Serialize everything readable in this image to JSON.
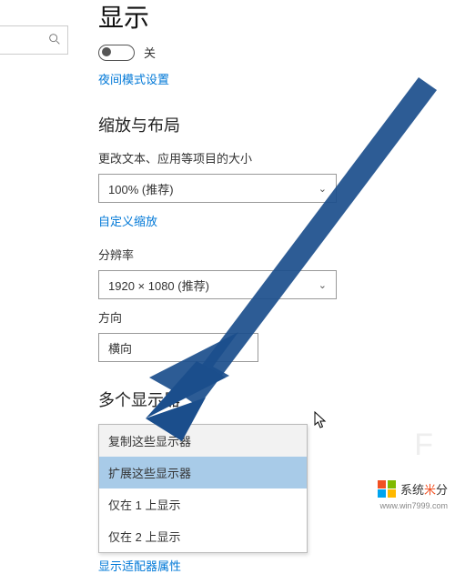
{
  "page": {
    "title": "显示"
  },
  "night_light": {
    "toggle_label": "关",
    "settings_link": "夜间模式设置"
  },
  "scale_layout": {
    "header": "缩放与布局",
    "text_size_label": "更改文本、应用等项目的大小",
    "text_size_value": "100% (推荐)",
    "custom_scaling_link": "自定义缩放",
    "resolution_label": "分辨率",
    "resolution_value": "1920 × 1080 (推荐)",
    "orientation_label": "方向",
    "orientation_value": "横向"
  },
  "multi_display": {
    "header": "多个显示器",
    "options": [
      "复制这些显示器",
      "扩展这些显示器",
      "仅在 1 上显示",
      "仅在 2 上显示"
    ],
    "selected_index": 1,
    "adapter_link": "显示适配器属性"
  },
  "watermark": {
    "text_prefix": "系统",
    "text_accent": "米",
    "text_suffix": "分",
    "url": "www.win7999.com"
  },
  "arrow_color": "#1b4e8c"
}
